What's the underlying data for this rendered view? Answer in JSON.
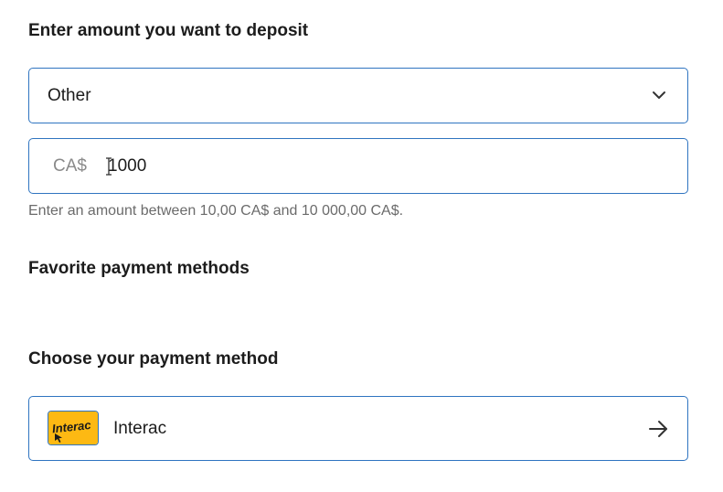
{
  "deposit": {
    "heading": "Enter amount you want to deposit",
    "preset_select": {
      "value": "Other",
      "icon": "chevron-down-icon"
    },
    "amount": {
      "prefix": "CA$",
      "value": "1000"
    },
    "hint": "Enter an amount between 10,00 CA$ and 10 000,00 CA$."
  },
  "favorites": {
    "heading": "Favorite payment methods"
  },
  "payment": {
    "heading": "Choose your payment method",
    "methods": [
      {
        "label": "Interac",
        "logo_text": "Interac",
        "icon": "arrow-right-icon",
        "logo_color": "#fdb913"
      }
    ]
  },
  "colors": {
    "border_accent": "#2f74c0",
    "hint_text": "#6b6b6b",
    "prefix_text": "#8a8a8a"
  }
}
